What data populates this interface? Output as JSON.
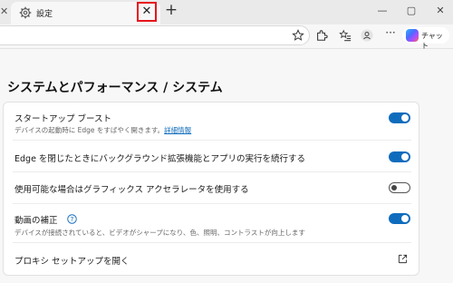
{
  "browser": {
    "tab_title": "設定",
    "close_tab_glyph": "✕",
    "new_tab_glyph": "+",
    "window": {
      "minimize": "—",
      "maximize": "▢",
      "close": "✕"
    },
    "toolbar": {
      "icons": [
        "star-icon",
        "extensions-icon",
        "favorites-icon",
        "profile-icon",
        "more-icon"
      ],
      "more_glyph": "···",
      "copilot_label": "チャット"
    }
  },
  "page": {
    "title": "システムとパフォーマンス / システム",
    "settings": [
      {
        "label": "スタートアップ ブースト",
        "description": "デバイスの起動時に Edge をすばやく開きます。",
        "link": "詳細情報",
        "state": "on"
      },
      {
        "label": "Edge を閉じたときにバックグラウンド拡張機能とアプリの実行を続行する",
        "state": "on"
      },
      {
        "label": "使用可能な場合はグラフィックス アクセラレータを使用する",
        "state": "off"
      },
      {
        "label": "動画の補正",
        "description": "デバイスが接続されていると、ビデオがシャープになり、色、照明、コントラストが向上します",
        "state": "on"
      },
      {
        "label": "プロキシ セットアップを開く"
      }
    ]
  },
  "colors": {
    "accent": "#0f6cbd",
    "highlight_box": "#e8131b"
  }
}
